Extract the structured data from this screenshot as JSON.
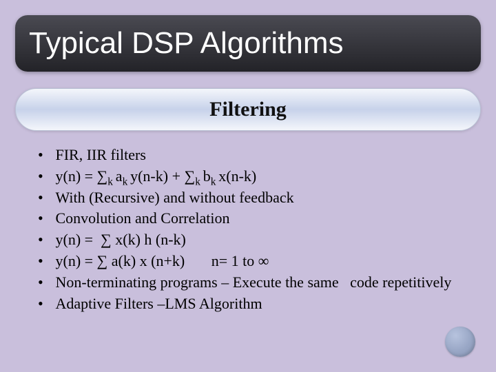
{
  "title": "Typical DSP Algorithms",
  "subtitle": "Filtering",
  "bullets": [
    {
      "text": " FIR, IIR filters"
    },
    {
      "html": " y(n) = ∑<span class=\"sub\">k </span>a<span class=\"sub\">k </span>y(n-k) + ∑<span class=\"sub\">k </span>b<span class=\"sub\">k </span>x(n-k)"
    },
    {
      "text": " With (Recursive) and without feedback"
    },
    {
      "text": " Convolution and Correlation"
    },
    {
      "text": " y(n) =  ∑ x(k) h (n-k)"
    },
    {
      "text": " y(n) = ∑ a(k) x (n+k)       n= 1 to ∞"
    },
    {
      "text": " Non-terminating programs – Execute the same   code repetitively"
    },
    {
      "text": " Adaptive Filters –LMS Algorithm"
    }
  ]
}
